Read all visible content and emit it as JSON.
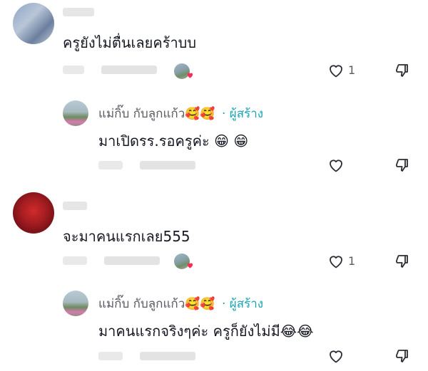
{
  "comments": [
    {
      "text": "ครูยังไม่ตื่นเลยคร้าบบ",
      "like_count": "1",
      "reply": {
        "author": "แม่กิ๊บ กับลูกแก้ว🥰🥰",
        "creator_tag": "· ผู้สร้าง",
        "text": "มาเปิดรร.รอครูค่ะ 😁 😁"
      }
    },
    {
      "text": "จะมาคนแรกเลย555",
      "like_count": "1",
      "reply": {
        "author": "แม่กิ๊บ กับลูกแก้ว🥰🥰",
        "creator_tag": "· ผู้สร้าง",
        "text": "มาคนแรกจริงๆค่ะ ครูก็ยังไม่มี😂😂"
      }
    }
  ],
  "icons": {
    "like": "heart-outline-icon",
    "dislike": "thumbs-down-icon",
    "creator_liked": "red-heart-badge-icon"
  },
  "colors": {
    "text": "#161823",
    "secondary": "#5a5b63",
    "creator_tag": "#1aa5b5",
    "heart_badge": "#fe2c55"
  }
}
